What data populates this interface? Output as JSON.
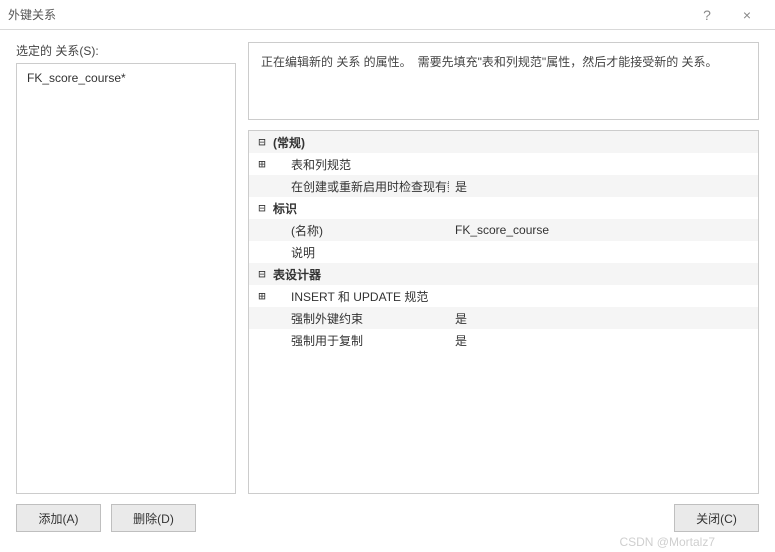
{
  "window": {
    "title": "外键关系",
    "help_icon": "?",
    "close_icon": "×"
  },
  "left": {
    "label": "选定的 关系(S):",
    "items": [
      "FK_score_course*"
    ]
  },
  "description": "正在编辑新的 关系 的属性。　需要先填充\"表和列规范\"属性，然后才能接受新的 关系。",
  "properties": {
    "cat_general": "(常规)",
    "general_rows": [
      {
        "exp": "⊞",
        "label": "表和列规范",
        "value": ""
      },
      {
        "exp": "",
        "label": "在创建或重新启用时检查现有数",
        "value": "是"
      }
    ],
    "cat_identity": "标识",
    "identity_rows": [
      {
        "exp": "",
        "label": "(名称)",
        "value": "FK_score_course"
      },
      {
        "exp": "",
        "label": "说明",
        "value": ""
      }
    ],
    "cat_designer": "表设计器",
    "designer_rows": [
      {
        "exp": "⊞",
        "label": "INSERT 和 UPDATE 规范",
        "value": ""
      },
      {
        "exp": "",
        "label": "强制外键约束",
        "value": "是"
      },
      {
        "exp": "",
        "label": "强制用于复制",
        "value": "是"
      }
    ],
    "expand_open": "⊟",
    "expand_closed": "⊞"
  },
  "buttons": {
    "add": "添加(A)",
    "delete": "删除(D)",
    "close": "关闭(C)"
  },
  "watermark": "CSDN @Mortalz7"
}
